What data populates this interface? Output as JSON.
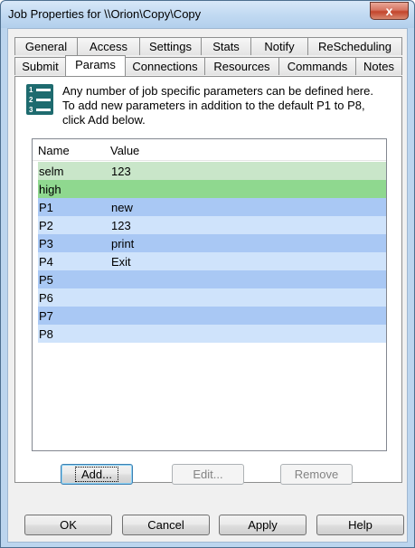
{
  "window": {
    "title": "Job Properties for \\\\Orion\\Copy\\Copy",
    "close_glyph": "x"
  },
  "tabs_row1": [
    "General",
    "Access",
    "Settings",
    "Stats",
    "Notify",
    "ReScheduling"
  ],
  "tabs_row2": [
    "Submit",
    "Params",
    "Connections",
    "Resources",
    "Commands",
    "Notes"
  ],
  "active_tab": "Params",
  "panel": {
    "icon_numbers": [
      "1",
      "2",
      "3"
    ],
    "description": "Any number of job specific parameters can be defined here. To add new parameters in addition to the default P1 to P8, click Add below."
  },
  "table": {
    "headers": {
      "name": "Name",
      "value": "Value"
    },
    "rows": [
      {
        "name": "selm",
        "value": "123",
        "color": "#c9e6c9"
      },
      {
        "name": "high",
        "value": "",
        "color": "#8fd88f"
      },
      {
        "name": "P1",
        "value": "new",
        "color": "#a9c8f4"
      },
      {
        "name": "P2",
        "value": "123",
        "color": "#cfe3fb"
      },
      {
        "name": "P3",
        "value": "print",
        "color": "#a9c8f4"
      },
      {
        "name": "P4",
        "value": "Exit",
        "color": "#cfe3fb"
      },
      {
        "name": "P5",
        "value": "",
        "color": "#a9c8f4"
      },
      {
        "name": "P6",
        "value": "",
        "color": "#cfe3fb"
      },
      {
        "name": "P7",
        "value": "",
        "color": "#a9c8f4"
      },
      {
        "name": "P8",
        "value": "",
        "color": "#cfe3fb"
      }
    ]
  },
  "param_buttons": {
    "add": "Add...",
    "edit": "Edit...",
    "remove": "Remove"
  },
  "dialog_buttons": {
    "ok": "OK",
    "cancel": "Cancel",
    "apply": "Apply",
    "help": "Help"
  }
}
